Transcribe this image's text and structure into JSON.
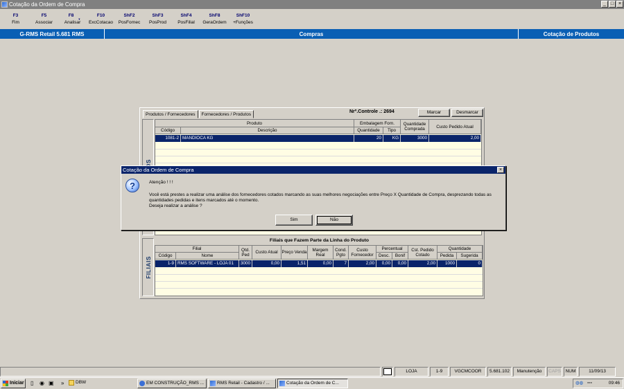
{
  "window": {
    "title": "Cotação da Ordem de Compra",
    "controls": [
      "_",
      "□",
      "×"
    ]
  },
  "fkeys": [
    {
      "key": "F3",
      "label": "Fim"
    },
    {
      "key": "F5",
      "label": "Associar"
    },
    {
      "key": "F8",
      "label": "Analisar"
    },
    {
      "key": "F10",
      "label": "ExcCotacao"
    },
    {
      "key": "ShF2",
      "label": "PosFornec"
    },
    {
      "key": "ShF3",
      "label": "PosProd"
    },
    {
      "key": "ShF4",
      "label": "PosFilial"
    },
    {
      "key": "ShF8",
      "label": "GeraOrdem"
    },
    {
      "key": "ShF10",
      "label": "+Funções"
    }
  ],
  "bluebar": {
    "left": "G-RMS Retail 5.681 RMS",
    "center": "Compras",
    "right": "Cotação de Produtos"
  },
  "panel": {
    "tab1": "Produtos / Fornecedores",
    "tab2": "Fornecedores / Produtos",
    "controle_label": "Nrº.Controle .: 2694",
    "marcar": "Marcar",
    "desmarcar": "Desmarcar",
    "produtos_label": "PRODUTOS",
    "filiais_label": "FILIAIS"
  },
  "produtos": {
    "group_produto": "Produto",
    "group_embalagem": "Embalagem Forn.",
    "h_codigo": "Código",
    "h_descricao": "Descrição",
    "h_quantidade": "Quantidade",
    "h_tipo": "Tipo",
    "h_qtd_comprada": "Quantidade Comprada",
    "h_custo_pedido": "Custo Pedido Atual",
    "rows": [
      {
        "codigo": "1081-2",
        "descricao": "MANDIOCA KG",
        "quantidade": "20",
        "tipo": "KG",
        "qtd_comprada": "3000",
        "custo": "2,00"
      }
    ]
  },
  "filiais": {
    "title": "Filiais que Fazem Parte da Linha do Produto",
    "group_filial": "Filial",
    "h_codigo": "Código",
    "h_nome": "Nome",
    "h_qtd_ped": "Qtd. Ped",
    "h_custo_atual": "Custo Atual",
    "h_preco_venda": "Preço Venda",
    "h_margem_real": "Margem Real",
    "h_cond_pgto": "Cond. Pgto",
    "h_custo_fornecedor": "Custo Fornecedor",
    "group_percentual": "Percentual",
    "h_desc": "Desc.",
    "h_bonif": "Bonif",
    "h_cst_pedido": "Cst. Pedido Cotado",
    "group_quantidade": "Quantidade",
    "h_pedida": "Pedida",
    "h_sugerida": "Sugerida",
    "rows": [
      {
        "codigo": "1-9",
        "nome": "RMS SOFTWARE - LOJA 01",
        "qtd_ped": "3000",
        "custo_atual": "0,00",
        "preco_venda": "1,51",
        "margem_real": "0,00",
        "cond_pgto": "7",
        "custo_fornecedor": "2,00",
        "desc": "0,00",
        "bonif": "0,00",
        "cst_pedido": "2,00",
        "pedida": "1000",
        "sugerida": "0"
      }
    ]
  },
  "dialog": {
    "title": "Cotação da Ordem de Compra",
    "close": "×",
    "atencao": "Atenção ! ! !",
    "line1": "Você está prestes a realizar uma análise dos fornecedores cotados marcando as suas melhores negociações entre Preço X Quantidade de Compra, desprezando todas as",
    "line2": "quantidades pedidas e itens marcados até o momento.",
    "line3": "Deseja realizar a análise ?",
    "sim": "Sim",
    "nao": "Não"
  },
  "statusbar": {
    "loja": "LOJA",
    "filial": "1-9",
    "user": "VGCMCOOR",
    "version": "5.681.102",
    "mode": "Manutenção",
    "caps": "CAPS",
    "num": "NUM",
    "date": "11/09/13"
  },
  "taskbar": {
    "start": "Iniciar",
    "folder": "DBW",
    "items": [
      "EM CONSTRUÇÃO_RMS ...",
      "RMS Retail - Cadastro / ...",
      "Cotação da Ordem de C..."
    ],
    "clock": "09:46"
  }
}
